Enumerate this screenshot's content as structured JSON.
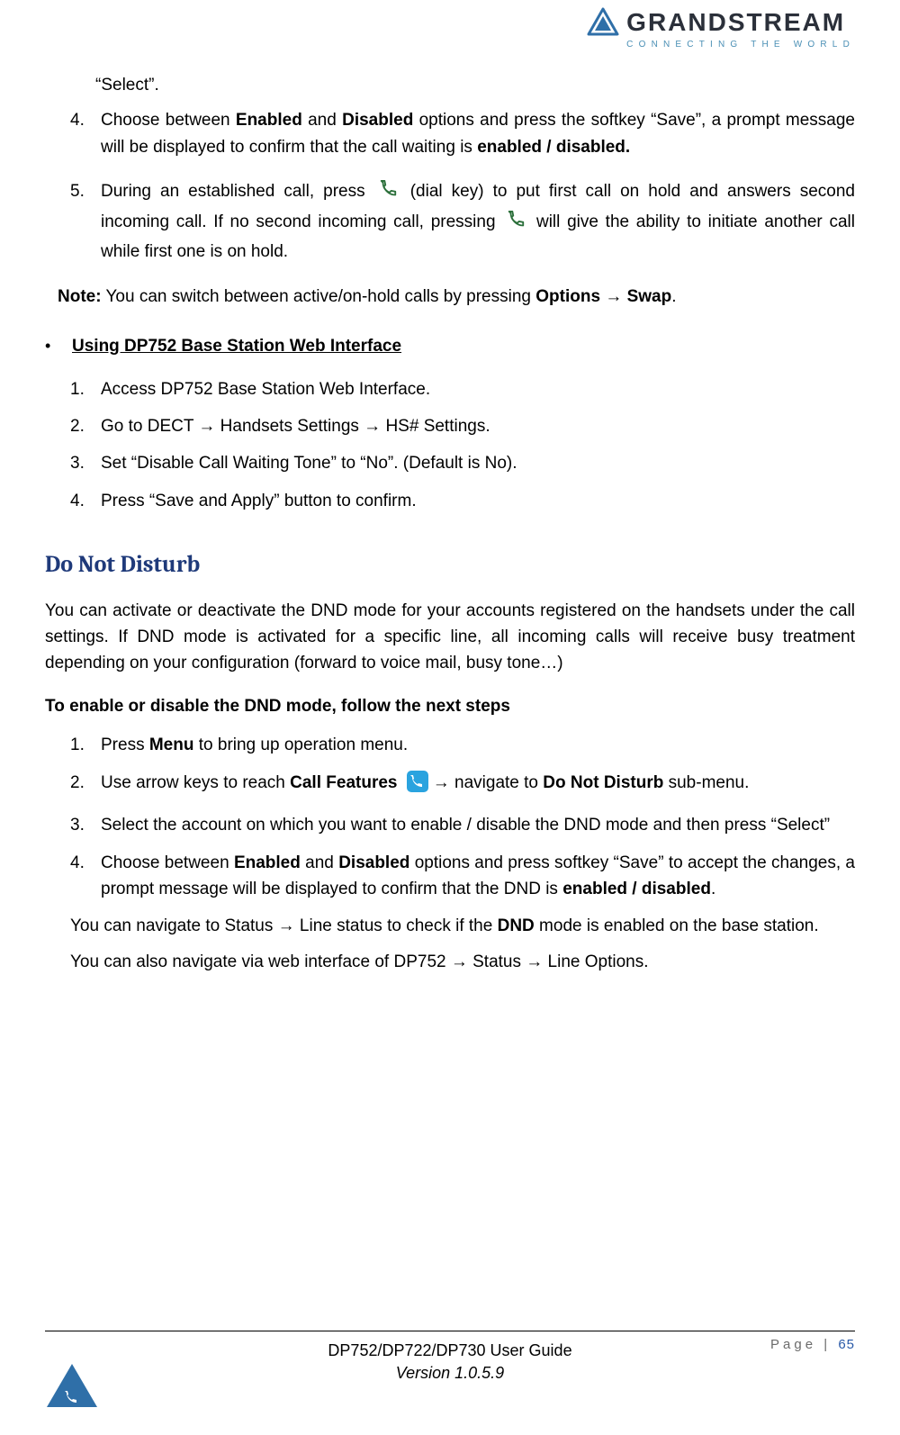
{
  "brand": {
    "name": "GRANDSTREAM",
    "tagline": "CONNECTING THE WORLD"
  },
  "topFrag": {
    "select": "“Select”.",
    "step4_a": "Choose between ",
    "step4_b": "Enabled",
    "step4_c": " and ",
    "step4_d": "Disabled",
    "step4_e": " options and press the softkey “Save”, a prompt message will be displayed to confirm that the call waiting is ",
    "step4_f": "enabled / disabled.",
    "step5_a": "During an established call, press ",
    "step5_b": " (dial key) to put first call on hold and answers second incoming call. If no second incoming call, pressing ",
    "step5_c": " will give the ability to initiate another call while first one is on hold.",
    "note_a": "Note:",
    "note_b": " You can switch between active/on-hold calls by pressing ",
    "note_c": "Options ",
    "note_arrow": "→",
    "note_d": " Swap",
    "note_e": "."
  },
  "webIf": {
    "heading": "Using DP752 Base Station Web Interface",
    "s1": "Access DP752 Base Station Web Interface.",
    "s2_a": "Go to DECT ",
    "s2_b": " Handsets Settings ",
    "s2_c": " HS# Settings.",
    "s3": "Set “Disable Call Waiting Tone” to “No”. (Default is No).",
    "s4": "Press “Save and Apply” button to confirm."
  },
  "dnd": {
    "title": "Do Not Disturb",
    "intro": "You can activate or deactivate the DND mode for your accounts registered on the handsets under the call settings. If DND mode is activated for a specific line, all incoming calls will receive busy treatment depending on your configuration (forward to voice mail, busy tone…)",
    "lead": "To enable or disable the DND mode, follow the next steps",
    "s1_a": "Press ",
    "s1_b": "Menu",
    "s1_c": " to bring up operation menu.",
    "s2_a": "Use arrow keys to reach ",
    "s2_b": "Call Features",
    "s2_c": " ",
    "s2_arrow": "→",
    "s2_d": " navigate to ",
    "s2_e": "Do Not Disturb",
    "s2_f": " sub-menu.",
    "s3": "Select the account on which you want to enable / disable the DND mode and then press “Select”",
    "s4_a": "Choose between ",
    "s4_b": "Enabled",
    "s4_c": " and ",
    "s4_d": "Disabled",
    "s4_e": " options and press softkey “Save” to accept the changes, a prompt message will be displayed to confirm that the DND is ",
    "s4_f": "enabled / disabled",
    "s4_g": ".",
    "tail1_a": "You can navigate to Status ",
    "tail1_b": " Line status to check if the ",
    "tail1_c": "DND",
    "tail1_d": " mode is enabled on the base station.",
    "tail2_a": "You can also navigate via web interface of DP752 ",
    "tail2_b": " Status ",
    "tail2_c": " Line Options."
  },
  "footer": {
    "title": "DP752/DP722/DP730 User Guide",
    "version": "Version 1.0.5.9",
    "pageLabel": "Page | ",
    "pageNum": "65"
  },
  "nums": {
    "n1": "1.",
    "n2": "2.",
    "n3": "3.",
    "n4": "4.",
    "n5": "5."
  },
  "sym": {
    "arrow": "→"
  }
}
